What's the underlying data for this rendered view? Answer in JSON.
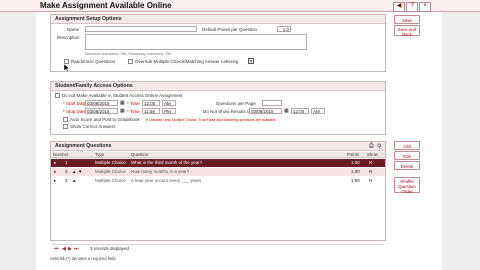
{
  "window": {
    "title": "Make Assignment Available Online",
    "controls": [
      "◀",
      "?",
      "×"
    ]
  },
  "setup": {
    "heading": "Assignment Setup Options",
    "name_label": "Name",
    "name_value": "",
    "points_label": "Default Points per Question",
    "points_value": "1.0",
    "description_label": "Description",
    "char_note": "Maximum characters: 256; Remaining characters: 256",
    "randomize_label": "Randomize Questions",
    "override_label": "Override Multiple Choice/Matching Answer Lettering",
    "override_help": "?"
  },
  "access": {
    "heading": "Student/Family Access Options",
    "do_not_available_label": "Do not Make Available in Student Access Online Assignment",
    "start_date_label": "* Start Date",
    "start_date": "03/08/2015",
    "start_time_label": "* Time",
    "start_time": "12:00",
    "start_ampm": "AM",
    "stop_date_label": "* Stop Date",
    "stop_date": "03/08/2015",
    "stop_time_label": "* Time",
    "stop_time": "11:59",
    "stop_ampm": "PM",
    "qpp_label": "Questions per Page",
    "qpp_value": "",
    "show_results_label": "Do Not Show Results Until",
    "show_results_date": "03/08/2015",
    "show_results_time": "12:00",
    "show_results_ampm": "AM",
    "auto_score_label": "Auto Score and Post to Gradebook",
    "auto_score_note": "If checked, only Multiple Choice, True/False and Matching questions are available",
    "show_correct_label": "Show Correct Answers"
  },
  "questions": {
    "heading": "Assignment Questions",
    "columns": [
      "Number",
      "Type",
      "Question",
      "Points",
      "Show"
    ],
    "rows": [
      {
        "number": "1",
        "type": "Multiple Choice",
        "question": "What is the third month of the year?",
        "points": "1.00",
        "show": "N"
      },
      {
        "number": "2",
        "type": "Multiple Choice",
        "question": "How many months in a year?",
        "points": "1.00",
        "show": "N"
      },
      {
        "number": "3",
        "type": "Multiple Choice",
        "question": "A leap year occurs every ___ years",
        "points": "1.00",
        "show": "N"
      }
    ],
    "records_text": "3 records displayed",
    "pager": [
      "⏮",
      "◀",
      "▶",
      "⏭"
    ]
  },
  "side_buttons": {
    "save": "Save",
    "save_and_back": "Save and Back",
    "add": "Add",
    "edit": "Edit",
    "delete": "Delete",
    "shuffle": "Shuffle Question Order"
  },
  "footer": {
    "required_note": "Asterisk (*) denotes a required field."
  },
  "colors": {
    "accent": "#6b1b23",
    "border": "#c8b7b9",
    "header_bg": "#f6e9ea"
  }
}
